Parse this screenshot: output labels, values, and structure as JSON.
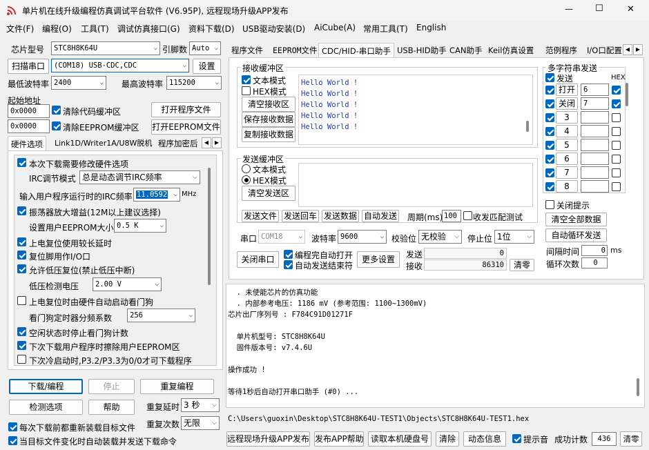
{
  "window": {
    "title": "单片机在线升级编程仿真调试平台软件 (V6.95P), 远程现场升级APP发布",
    "minimize": "—",
    "maximize": "☐",
    "close": "✕"
  },
  "menu": [
    "文件(F)",
    "编程(O)",
    "工具(T)",
    "调试仿真接口(G)",
    "资料下载(D)",
    "USB驱动安装(D)",
    "AiCube(A)",
    "常用工具(T)",
    "English"
  ],
  "left": {
    "chip_label": "芯片型号",
    "chip_value": "STC8H8K64U",
    "pins_label": "引脚数",
    "pins_value": "Auto",
    "scan_label": "扫描串口",
    "port_value": "(COM18) USB-CDC,CDC",
    "settings_btn": "设置",
    "min_baud_label": "最低波特率",
    "min_baud": "2400",
    "max_baud_label": "最高波特率",
    "max_baud": "115200",
    "start_addr_label": "起始地址",
    "addr1": "0x0000",
    "clear_code": "清除代码缓冲区",
    "open_prog": "打开程序文件",
    "addr2": "0x0000",
    "clear_eeprom": "清除EEPROM缓冲区",
    "open_eeprom": "打开EEPROM文件",
    "tabs": [
      "硬件选项",
      "Link1D/Writer1A/U8W脱机",
      "程序加密后"
    ],
    "hw": {
      "opt1": "本次下载需要修改硬件选项",
      "irc_mode_label": "IRC调节模式",
      "irc_mode_value": "总是动态调节IRC频率",
      "irc_freq_label": "输入用户程序运行时的IRC频率",
      "irc_freq_value": "11.0592",
      "irc_unit": "MHz",
      "opt2": "振荡器放大增益(12M以上建议选择)",
      "eeprom_size_label": "设置用户EEPROM大小",
      "eeprom_size_value": "0.5 K",
      "opt3": "上电复位使用较长延时",
      "opt4": "复位脚用作I/O口",
      "opt5": "允许低压复位(禁止低压中断)",
      "lvd_label": "低压检测电压",
      "lvd_value": "2.00 V",
      "opt6": "上电复位时由硬件自动启动看门狗",
      "wdt_label": "看门狗定时器分频系数",
      "wdt_value": "256",
      "opt7": "空闲状态时停止看门狗计数",
      "opt8": "下次下载用户程序时擦除用户EEPROM区",
      "opt9": "下次冷启动时,P3.2/P3.3为0/0才可下载程序"
    },
    "download_btn": "下载/编程",
    "stop_btn": "停止",
    "reprogram_btn": "重复编程",
    "check_btn": "检测选项",
    "help_btn": "帮助",
    "repeat_delay_label": "重复延时",
    "repeat_delay": "3 秒",
    "repeat_count_label": "重复次数",
    "repeat_count": "无限",
    "reload_opt": "每次下载前都重新装载目标文件",
    "auto_load_opt": "当目标文件变化时自动装载并发送下载命令"
  },
  "right": {
    "tabs": [
      "程序文件",
      "EEPROM文件",
      "CDC/HID-串口助手",
      "USB-HID助手",
      "CAN助手",
      "Keil仿真设置",
      "范例程序",
      "I/O口配置"
    ],
    "recv": {
      "title": "接收缓冲区",
      "text_mode": "文本模式",
      "hex_mode": "HEX模式",
      "clear": "清空接收区",
      "save": "保存接收数据",
      "copy": "复制接收数据",
      "lines": [
        "Hello World !",
        "Hello World !",
        "Hello World !",
        "Hello World !",
        "Hello World !"
      ]
    },
    "send": {
      "title": "发送缓冲区",
      "text_mode": "文本模式",
      "hex_mode": "HEX模式",
      "clear": "清空发送区",
      "send_file": "发送文件",
      "send_cr": "发送回车",
      "send_data": "发送数据",
      "auto_send": "自动发送",
      "period_label": "周期(ms)",
      "period": "100",
      "match_test": "收发匹配测试"
    },
    "multi": {
      "title": "多字符串发送",
      "send_label": "发送",
      "hex_label": "HEX",
      "rows": [
        {
          "label": "打开",
          "value": "6",
          "hex": true
        },
        {
          "label": "关闭",
          "value": "7",
          "hex": true
        },
        {
          "label": "3",
          "value": "",
          "hex": false
        },
        {
          "label": "4",
          "value": "",
          "hex": false
        },
        {
          "label": "5",
          "value": "",
          "hex": false
        },
        {
          "label": "6",
          "value": "",
          "hex": false
        },
        {
          "label": "7",
          "value": "",
          "hex": false
        },
        {
          "label": "8",
          "value": "",
          "hex": false
        }
      ],
      "close_hint": "关闭提示",
      "clear_all": "清空全部数据",
      "auto_loop": "自动循环发送",
      "interval_label": "间隔时间",
      "interval": "0",
      "interval_unit": "ms",
      "loop_label": "循环次数",
      "loop": "0"
    },
    "port": {
      "port_label": "串口",
      "port_value": "COM18",
      "baud_label": "波特率",
      "baud_value": "9600",
      "parity_label": "校验位",
      "parity_value": "无校验",
      "stop_label": "停止位",
      "stop_value": "1位",
      "close_port": "关闭串口",
      "auto_open": "编程完自动打开",
      "auto_send_end": "自动发送结束符",
      "more": "更多设置",
      "send_label": "发送",
      "send_count": "0",
      "recv_label": "接收",
      "recv_count": "86310",
      "clear": "清零"
    },
    "log": [
      "  . 未使能芯片的仿真功能",
      "  . 内部参考电压: 1186 mV (参考范围: 1100~1300mV)",
      "芯片出厂序列号 : F784C91D01271F",
      "",
      "  单片机型号: STC8H8K64U",
      "  固件版本号: v7.4.6U",
      "",
      "操作成功 !",
      "",
      "等待1秒后自动打开串口助手 (#0) ..."
    ],
    "path": "C:\\Users\\guoxin\\Desktop\\STC8H8K64U-TEST1\\Objects\\STC8H8K64U-TEST1.hex",
    "bottom": {
      "remote": "远程现场升级APP发布",
      "publish_help": "发布APP帮助",
      "read_disk": "读取本机硬盘号",
      "clear": "清除",
      "dynamic": "动态信息",
      "beep": "提示音",
      "success_label": "成功计数",
      "success": "436",
      "zero": "清零"
    }
  }
}
